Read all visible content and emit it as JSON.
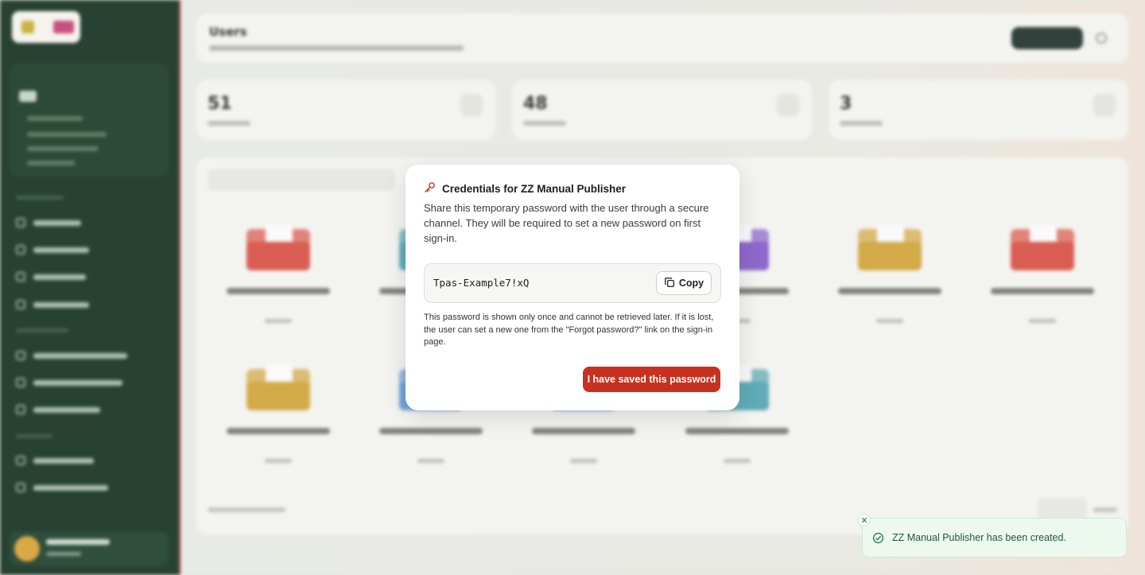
{
  "background": {
    "page_title": "Users",
    "stats": [
      "51",
      "48",
      "3"
    ],
    "folder_colors": {
      "red": "#d9574c",
      "teal": "#5aa8b6",
      "purple": "#8a62c9",
      "gold": "#d2a741",
      "blue": "#6a9fd6"
    }
  },
  "dialog": {
    "title": "Credentials for ZZ Manual Publisher",
    "description": "Share this temporary password with the user through a secure channel. They will be required to set a new password on first sign-in.",
    "password": "Tpas-Example7!xQ",
    "copy_label": "Copy",
    "note": "This password is shown only once and cannot be retrieved later. If it is lost, the user can set a new one from the \"Forgot password?\" link on the sign-in page.",
    "confirm_label": "I have saved this password",
    "accent_color": "#c8311f"
  },
  "toast": {
    "message": "ZZ Manual Publisher has been created."
  },
  "icons": {
    "title": "key-icon",
    "copy": "copy-icon",
    "toast": "check-circle-icon",
    "close": "close-icon"
  }
}
